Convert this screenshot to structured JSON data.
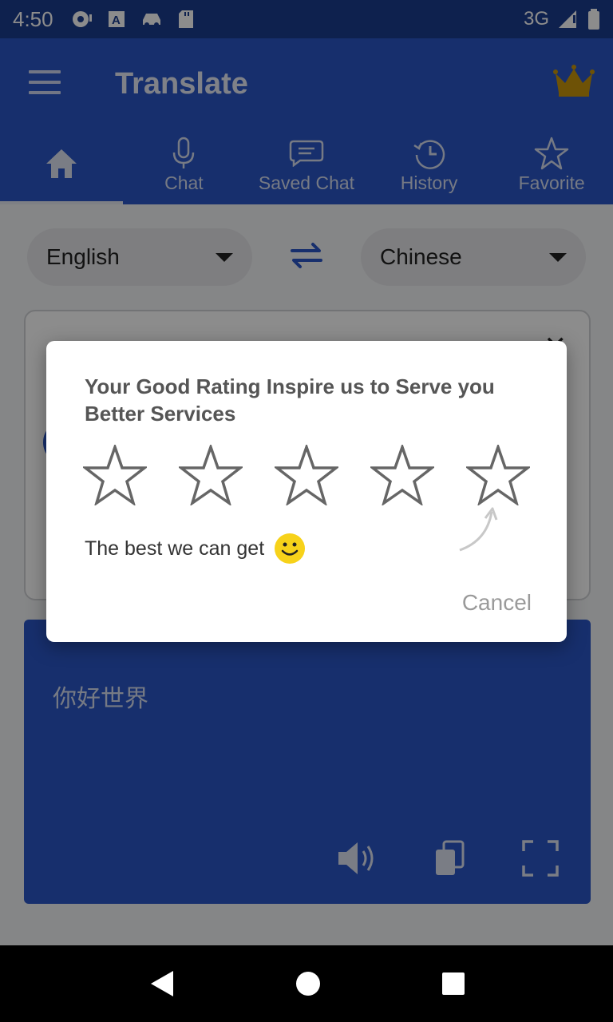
{
  "status": {
    "time": "4:50",
    "network": "3G"
  },
  "app": {
    "title": "Translate"
  },
  "tabs": [
    {
      "label": "",
      "icon": "home-icon"
    },
    {
      "label": "Chat",
      "icon": "mic-icon"
    },
    {
      "label": "Saved Chat",
      "icon": "chat-bubble-icon"
    },
    {
      "label": "History",
      "icon": "history-icon"
    },
    {
      "label": "Favorite",
      "icon": "star-icon"
    }
  ],
  "languages": {
    "source": "English",
    "target": "Chinese"
  },
  "output": {
    "text": "你好世界"
  },
  "dialog": {
    "title": "Your Good Rating Inspire us to Serve you Better Services",
    "message": "The best we can get",
    "cancel": "Cancel",
    "rating": 0,
    "max_rating": 5
  },
  "colors": {
    "primary": "#2a56c6",
    "crown": "#c8960c",
    "smiley": "#f7d21a"
  }
}
